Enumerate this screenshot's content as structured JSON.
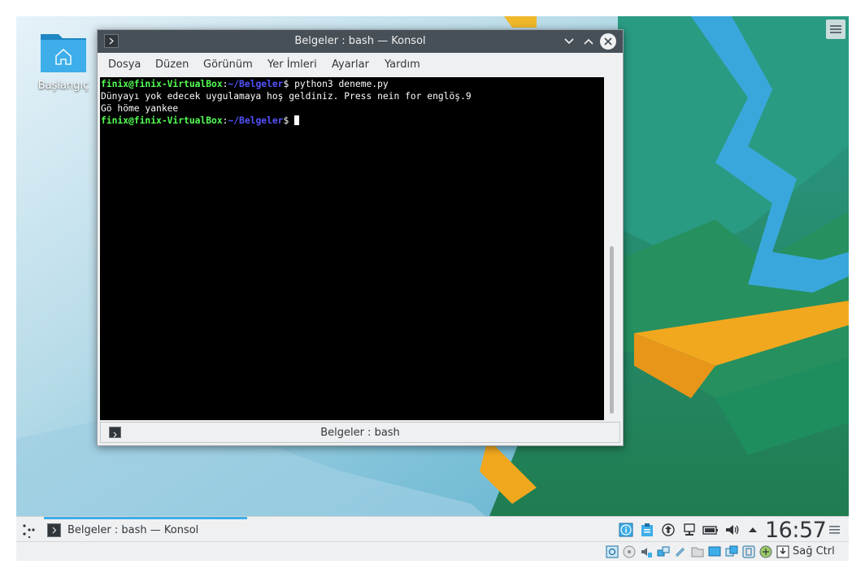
{
  "desktop": {
    "home_label": "Başlangıç"
  },
  "window": {
    "title": "Belgeler : bash — Konsol"
  },
  "menu": [
    "Dosya",
    "Düzen",
    "Görünüm",
    "Yer İmleri",
    "Ayarlar",
    "Yardım"
  ],
  "terminal": {
    "prompt_user": "finix@finix-VirtualBox",
    "prompt_sep": ":",
    "prompt_path": "~/Belgeler",
    "prompt_dollar": "$ ",
    "command": "python3 deneme.py",
    "output_1": "Dünyayı yok edecek uygulamaya hoş geldiniz. Press nein for englöş.9",
    "output_2": "Gö höme yankee"
  },
  "tab": {
    "label": "Belgeler : bash"
  },
  "taskbar": {
    "task_label": "Belgeler : bash — Konsol",
    "clock": "16:57"
  },
  "vbox": {
    "host_key": "Sağ Ctrl"
  },
  "colors": {
    "titlebar": "#475057",
    "panel": "#eff0f1",
    "prompt_user": "#54ff54",
    "prompt_path": "#5454ff",
    "accent": "#3daee9"
  },
  "icons": {
    "tray": [
      "info-icon",
      "klipper-icon",
      "updates-icon",
      "network-icon",
      "battery-icon",
      "volume-icon",
      "expand-tray-icon"
    ]
  }
}
